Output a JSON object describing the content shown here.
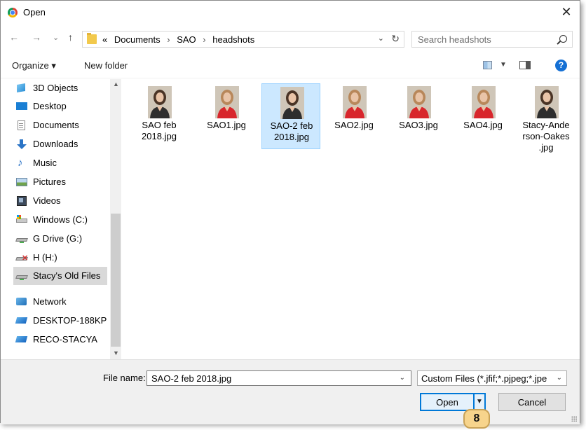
{
  "window": {
    "title": "Open",
    "close": "✕"
  },
  "nav": {
    "back": "←",
    "forward": "→",
    "recent": "⌄",
    "up": "↑"
  },
  "address": {
    "prefix": "«",
    "crumbs": [
      "Documents",
      "SAO",
      "headshots"
    ],
    "separator": "›",
    "dropdown": "⌄",
    "refresh": "↻"
  },
  "search": {
    "placeholder": "Search headshots"
  },
  "toolbar": {
    "organize": "Organize ▾",
    "new_folder": "New folder",
    "help": "?"
  },
  "sidebar": {
    "items": [
      {
        "label": "3D Objects",
        "icon": "3d-objects-icon"
      },
      {
        "label": "Desktop",
        "icon": "desktop-icon"
      },
      {
        "label": "Documents",
        "icon": "documents-icon"
      },
      {
        "label": "Downloads",
        "icon": "downloads-icon"
      },
      {
        "label": "Music",
        "icon": "music-icon"
      },
      {
        "label": "Pictures",
        "icon": "pictures-icon"
      },
      {
        "label": "Videos",
        "icon": "videos-icon"
      },
      {
        "label": "Windows (C:)",
        "icon": "drive-icon"
      },
      {
        "label": "G Drive (G:)",
        "icon": "network-drive-icon"
      },
      {
        "label": "H (H:)",
        "icon": "disconnected-drive-icon"
      },
      {
        "label": "Stacy's Old Files",
        "icon": "network-drive-icon",
        "selected": true
      },
      {
        "label": "Network",
        "icon": "network-icon"
      },
      {
        "label": "DESKTOP-188KP",
        "icon": "computer-icon"
      },
      {
        "label": "RECO-STACYA",
        "icon": "computer-icon"
      }
    ]
  },
  "files": [
    {
      "name_lines": [
        "SAO feb",
        "2018.jpg"
      ],
      "style": "beige"
    },
    {
      "name_lines": [
        "SAO1.jpg"
      ],
      "style": "red"
    },
    {
      "name_lines": [
        "SAO-2 feb",
        "2018.jpg"
      ],
      "style": "beige",
      "selected": true
    },
    {
      "name_lines": [
        "SAO2.jpg"
      ],
      "style": "red"
    },
    {
      "name_lines": [
        "SAO3.jpg"
      ],
      "style": "red"
    },
    {
      "name_lines": [
        "SAO4.jpg"
      ],
      "style": "red"
    },
    {
      "name_lines": [
        "Stacy-Ande",
        "rson-Oakes",
        ".jpg"
      ],
      "style": "beige"
    }
  ],
  "footer": {
    "file_name_label": "File name:",
    "file_name_value": "SAO-2 feb 2018.jpg",
    "file_type_value": "Custom Files (*.jfif;*.pjpeg;*.jpe",
    "open": "Open",
    "cancel": "Cancel",
    "dropdown": "⌄",
    "split_arrow": "▼"
  },
  "step_badge": "8",
  "colors": {
    "accent": "#0078d7",
    "selection": "#cce8ff",
    "badge": "#f7d48c"
  }
}
